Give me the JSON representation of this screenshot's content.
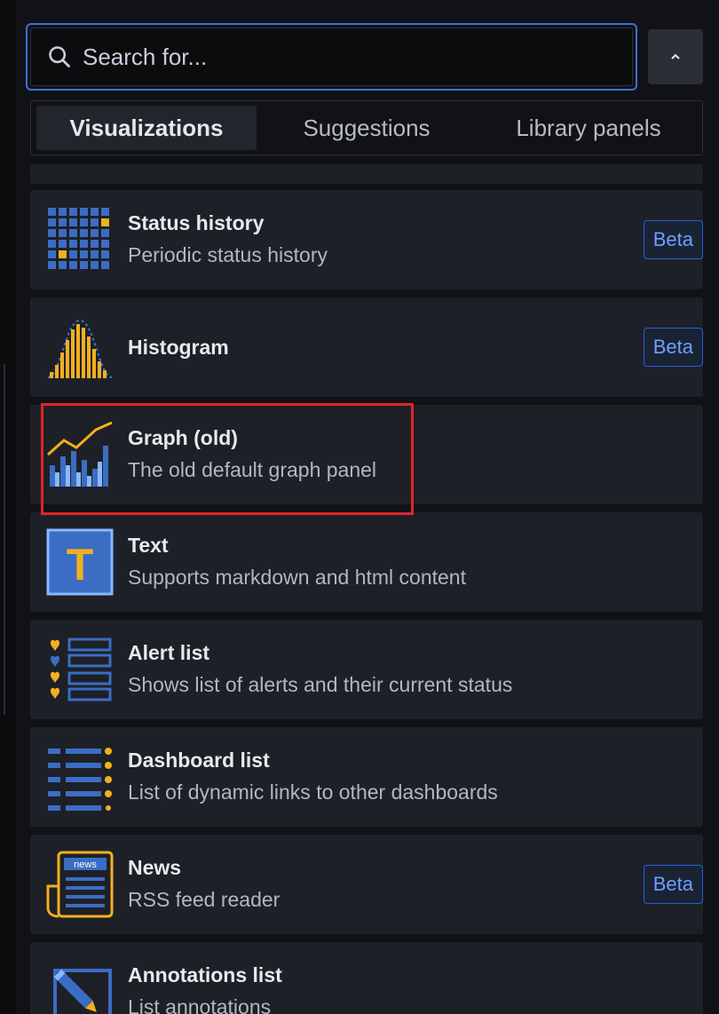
{
  "search": {
    "placeholder": "Search for..."
  },
  "tabs": [
    {
      "label": "Visualizations",
      "active": true
    },
    {
      "label": "Suggestions",
      "active": false
    },
    {
      "label": "Library panels",
      "active": false
    }
  ],
  "items": [
    {
      "title": "Status history",
      "description": "Periodic status history",
      "badge": "Beta",
      "icon": "status-history-icon"
    },
    {
      "title": "Histogram",
      "description": "",
      "badge": "Beta",
      "icon": "histogram-icon"
    },
    {
      "title": "Graph (old)",
      "description": "The old default graph panel",
      "badge": "",
      "icon": "graph-old-icon"
    },
    {
      "title": "Text",
      "description": "Supports markdown and html content",
      "badge": "",
      "icon": "text-icon"
    },
    {
      "title": "Alert list",
      "description": "Shows list of alerts and their current status",
      "badge": "",
      "icon": "alert-list-icon"
    },
    {
      "title": "Dashboard list",
      "description": "List of dynamic links to other dashboards",
      "badge": "",
      "icon": "dashboard-list-icon"
    },
    {
      "title": "News",
      "description": "RSS feed reader",
      "badge": "Beta",
      "icon": "news-icon"
    },
    {
      "title": "Annotations list",
      "description": "List annotations",
      "badge": "",
      "icon": "annotations-list-icon"
    }
  ],
  "news_icon_text": "news",
  "text_icon_letter": "T",
  "colors": {
    "accent": "#3d71d9",
    "blue": "#3b6dc4",
    "yellow": "#f2b01e",
    "highlight": "#e0252b"
  }
}
